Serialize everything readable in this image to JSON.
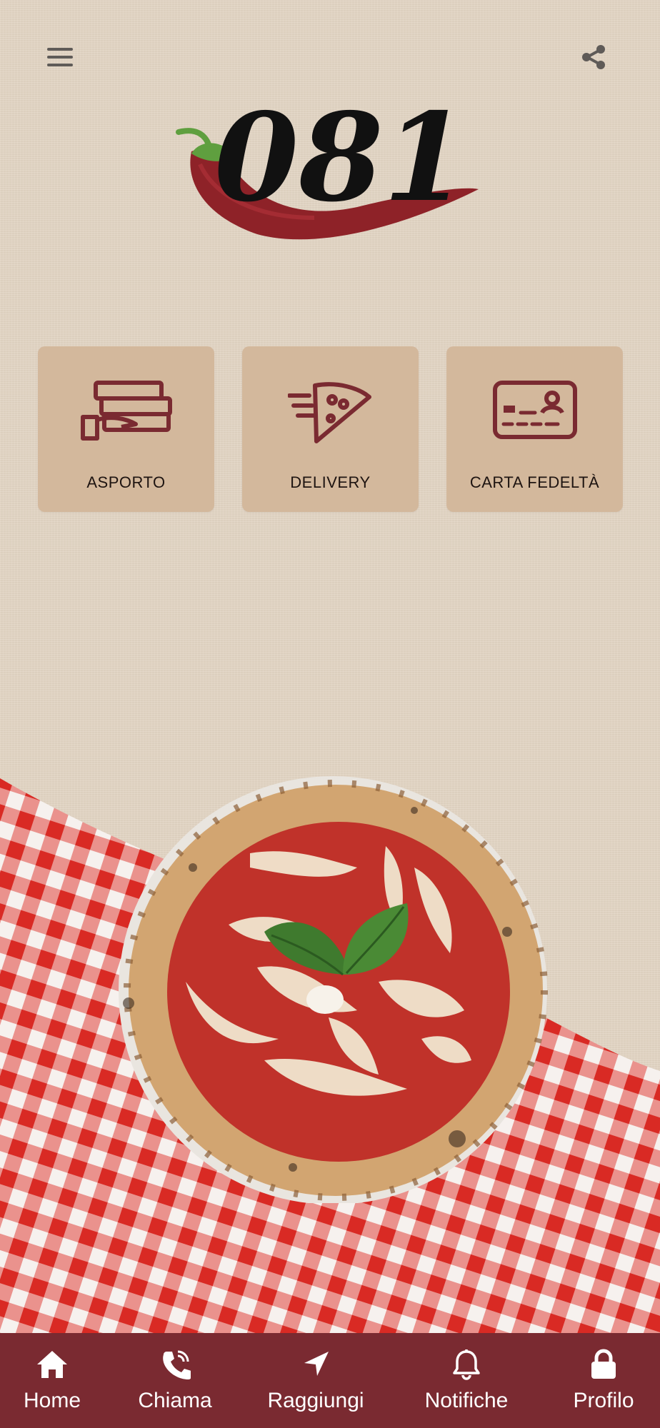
{
  "header": {
    "menu_icon": "hamburger-menu-icon",
    "share_icon": "share-icon",
    "logo_text": "081",
    "logo_icon": "chili-pepper-logo"
  },
  "tiles": [
    {
      "label": "ASPORTO",
      "icon": "pizza-boxes-hand-icon"
    },
    {
      "label": "DELIVERY",
      "icon": "fast-pizza-slice-icon"
    },
    {
      "label": "CARTA FEDELTÀ",
      "icon": "loyalty-card-icon"
    }
  ],
  "hero": {
    "image": "margherita-pizza-on-checkered-tablecloth"
  },
  "bottom_nav": [
    {
      "label": "Home",
      "icon": "home-icon"
    },
    {
      "label": "Chiama",
      "icon": "phone-call-icon"
    },
    {
      "label": "Raggiungi",
      "icon": "navigation-arrow-icon"
    },
    {
      "label": "Notifiche",
      "icon": "bell-icon"
    },
    {
      "label": "Profilo",
      "icon": "lock-icon"
    }
  ],
  "colors": {
    "background": "#e4d6c5",
    "tile": "#d3b89c",
    "accent": "#7a2a31",
    "tablecloth_red": "#d92a24"
  }
}
